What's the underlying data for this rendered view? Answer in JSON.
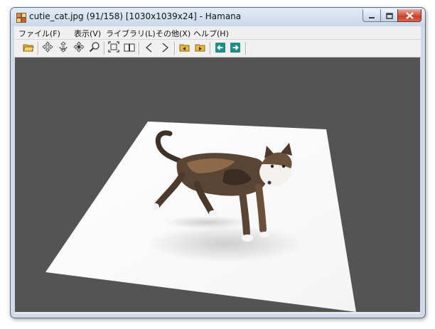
{
  "window": {
    "title": "cutie_cat.jpg (91/158) [1030x1039x24] - Hamana",
    "icons": {
      "app": "hamana-app-icon",
      "minimize": "minimize-icon",
      "maximize": "maximize-icon",
      "close": "close-icon"
    }
  },
  "menu": {
    "items": [
      "ファイル(F)",
      "表示(V)",
      "ライブラリ(L)",
      "その他(X)",
      "ヘルプ(H)"
    ]
  },
  "toolbar": {
    "icons": [
      "open-folder-icon",
      "move-icon",
      "rotate-icon",
      "pan-icon",
      "zoom-icon",
      "fit-window-icon",
      "two-page-icon",
      "previous-icon",
      "next-icon",
      "prev-folder-icon",
      "next-folder-icon",
      "back-icon",
      "forward-icon"
    ]
  },
  "viewer": {
    "background_color": "#545454",
    "image_subject": "cat-photo",
    "view_mode": "3d-perspective-plane"
  }
}
